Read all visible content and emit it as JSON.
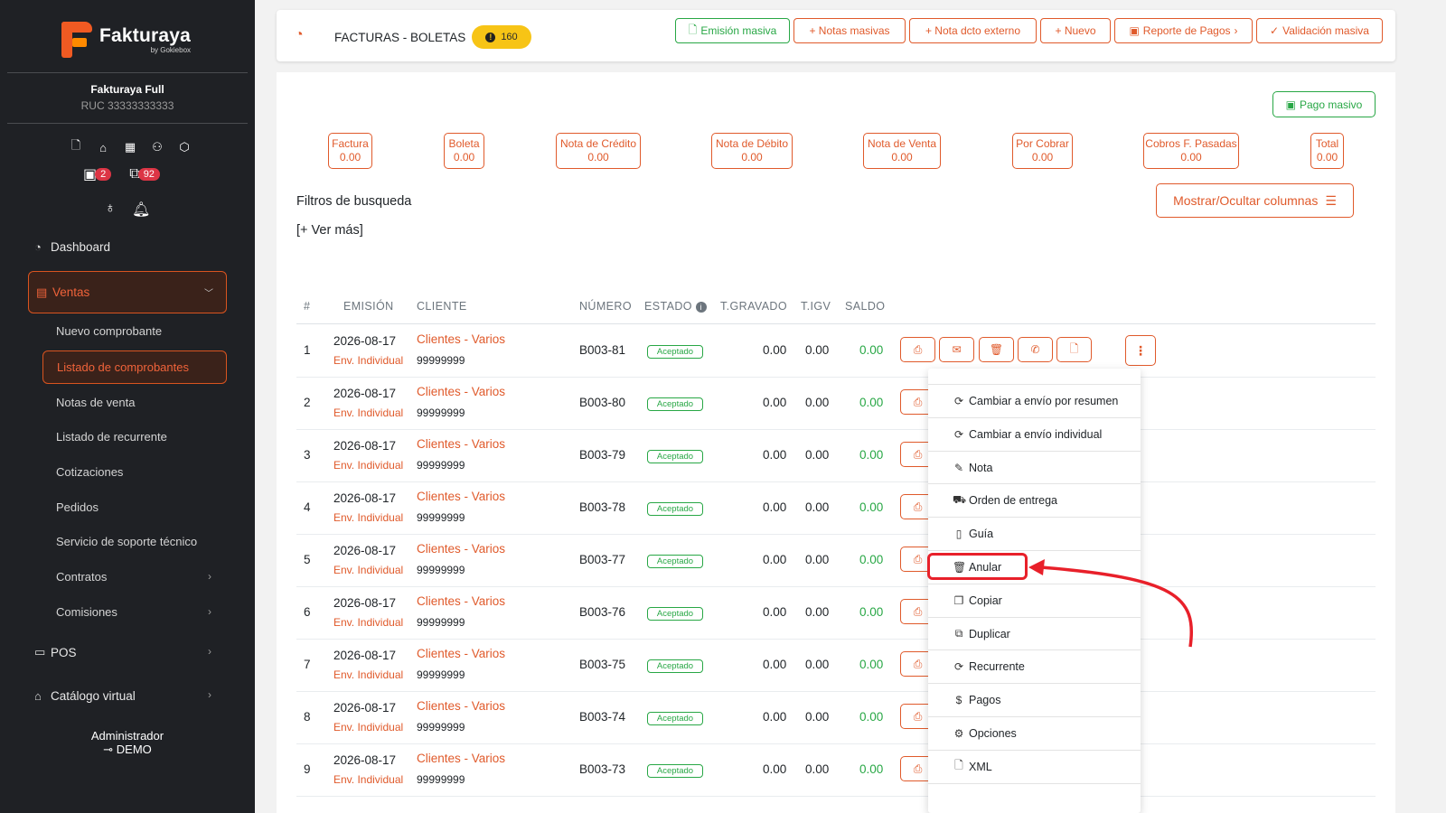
{
  "brand": {
    "name": "Fakturaya",
    "sub": "by Gokiebox"
  },
  "company": {
    "name": "Fakturaya Full",
    "ruc": "RUC 33333333333"
  },
  "sidebar": {
    "count_badges": [
      "2",
      "92"
    ],
    "dashboard": "Dashboard",
    "ventas": "Ventas",
    "sub_items": [
      "Nuevo comprobante",
      "Listado de comprobantes",
      "Notas de venta",
      "Listado de recurrente",
      "Cotizaciones",
      "Pedidos",
      "Servicio de soporte técnico",
      "Contratos",
      "Comisiones"
    ],
    "pos": "POS",
    "catalogo": "Catálogo virtual",
    "admin_role": "Administrador",
    "admin_user": "DEMO"
  },
  "header": {
    "title": "FACTURAS - BOLETAS",
    "badge_count": "160",
    "buttons": [
      "Emisión masiva",
      "+ Notas masivas",
      "+ Nota dcto externo",
      "+ Nuevo",
      "Reporte de Pagos",
      "Validación masiva"
    ]
  },
  "content": {
    "pago_masivo": "Pago masivo",
    "stats": [
      {
        "label": "Factura",
        "value": "0.00"
      },
      {
        "label": "Boleta",
        "value": "0.00"
      },
      {
        "label": "Nota de Crédito",
        "value": "0.00"
      },
      {
        "label": "Nota de Débito",
        "value": "0.00"
      },
      {
        "label": "Nota de Venta",
        "value": "0.00"
      },
      {
        "label": "Por Cobrar",
        "value": "0.00"
      },
      {
        "label": "Cobros F. Pasadas",
        "value": "0.00"
      },
      {
        "label": "Total",
        "value": "0.00"
      }
    ],
    "filters_title": "Filtros de busqueda",
    "ver_mas": "[+ Ver más]",
    "columns_button": "Mostrar/Ocultar columnas"
  },
  "table": {
    "headers": [
      "#",
      "EMISIÓN",
      "CLIENTE",
      "NÚMERO",
      "ESTADO",
      "T.GRAVADO",
      "T.IGV",
      "SALDO"
    ],
    "rows": [
      {
        "n": "1",
        "date": "2026-08-17",
        "env": "Env. Individual",
        "client": "Clientes - Varios",
        "doc": "99999999",
        "num": "B003-81",
        "estado": "Aceptado",
        "gravado": "0.00",
        "igv": "0.00",
        "saldo": "0.00"
      },
      {
        "n": "2",
        "date": "2026-08-17",
        "env": "Env. Individual",
        "client": "Clientes - Varios",
        "doc": "99999999",
        "num": "B003-80",
        "estado": "Aceptado",
        "gravado": "0.00",
        "igv": "0.00",
        "saldo": "0.00"
      },
      {
        "n": "3",
        "date": "2026-08-17",
        "env": "Env. Individual",
        "client": "Clientes - Varios",
        "doc": "99999999",
        "num": "B003-79",
        "estado": "Aceptado",
        "gravado": "0.00",
        "igv": "0.00",
        "saldo": "0.00"
      },
      {
        "n": "4",
        "date": "2026-08-17",
        "env": "Env. Individual",
        "client": "Clientes - Varios",
        "doc": "99999999",
        "num": "B003-78",
        "estado": "Aceptado",
        "gravado": "0.00",
        "igv": "0.00",
        "saldo": "0.00"
      },
      {
        "n": "5",
        "date": "2026-08-17",
        "env": "Env. Individual",
        "client": "Clientes - Varios",
        "doc": "99999999",
        "num": "B003-77",
        "estado": "Aceptado",
        "gravado": "0.00",
        "igv": "0.00",
        "saldo": "0.00"
      },
      {
        "n": "6",
        "date": "2026-08-17",
        "env": "Env. Individual",
        "client": "Clientes - Varios",
        "doc": "99999999",
        "num": "B003-76",
        "estado": "Aceptado",
        "gravado": "0.00",
        "igv": "0.00",
        "saldo": "0.00"
      },
      {
        "n": "7",
        "date": "2026-08-17",
        "env": "Env. Individual",
        "client": "Clientes - Varios",
        "doc": "99999999",
        "num": "B003-75",
        "estado": "Aceptado",
        "gravado": "0.00",
        "igv": "0.00",
        "saldo": "0.00"
      },
      {
        "n": "8",
        "date": "2026-08-17",
        "env": "Env. Individual",
        "client": "Clientes - Varios",
        "doc": "99999999",
        "num": "B003-74",
        "estado": "Aceptado",
        "gravado": "0.00",
        "igv": "0.00",
        "saldo": "0.00"
      },
      {
        "n": "9",
        "date": "2026-08-17",
        "env": "Env. Individual",
        "client": "Clientes - Varios",
        "doc": "99999999",
        "num": "B003-73",
        "estado": "Aceptado",
        "gravado": "0.00",
        "igv": "0.00",
        "saldo": "0.00"
      }
    ]
  },
  "dropdown": {
    "items": [
      {
        "icon": "refresh-icon",
        "label": "Cambiar a envío por resumen"
      },
      {
        "icon": "refresh-icon",
        "label": "Cambiar a envío individual"
      },
      {
        "icon": "edit-icon",
        "label": "Nota"
      },
      {
        "icon": "truck-icon",
        "label": "Orden de entrega"
      },
      {
        "icon": "book-icon",
        "label": "Guía"
      },
      {
        "icon": "trash-icon",
        "label": "Anular"
      },
      {
        "icon": "copy-icon",
        "label": "Copiar"
      },
      {
        "icon": "duplicate-icon",
        "label": "Duplicar"
      },
      {
        "icon": "refresh-icon",
        "label": "Recurrente"
      },
      {
        "icon": "dollar-icon",
        "label": "Pagos"
      },
      {
        "icon": "gear-icon",
        "label": "Opciones"
      },
      {
        "icon": "file-code-icon",
        "label": "XML"
      }
    ]
  },
  "colors": {
    "accent": "#e05a2b",
    "success": "#28a745",
    "sidebar_bg": "#1f2125",
    "badge_yellow": "#f7c416",
    "highlight": "#e8202a"
  }
}
